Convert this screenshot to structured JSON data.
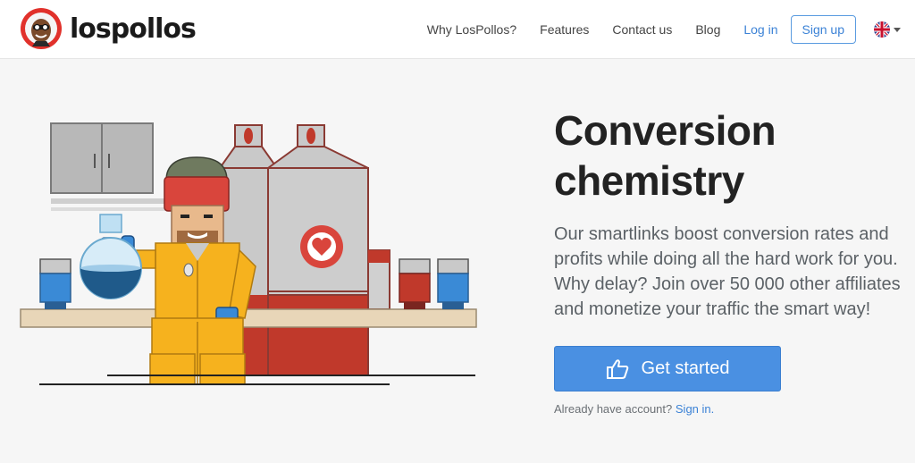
{
  "brand": {
    "logo_text": "lospollos",
    "logo_icon": "mascot-avatar-icon"
  },
  "nav": {
    "links": [
      "Why LosPollos?",
      "Features",
      "Contact us",
      "Blog"
    ],
    "login": "Log in",
    "signup": "Sign up",
    "language_icon": "uk-flag-icon"
  },
  "hero": {
    "headline": "Conversion chemistry",
    "subtext": "Our smartlinks boost conversion rates and profits while doing all the hard work for you. Why delay? Join over 50 000 other affiliates and monetize your traffic the smart way!",
    "cta_label": "Get started",
    "cta_icon": "thumbs-up-pointing-icon",
    "already_text": "Already have account?",
    "signin_link": "Sign in."
  },
  "colors": {
    "accent": "#4a90e2",
    "link": "#3b82d6",
    "heart_red": "#d9453c",
    "suit_yellow": "#f6b21e"
  }
}
